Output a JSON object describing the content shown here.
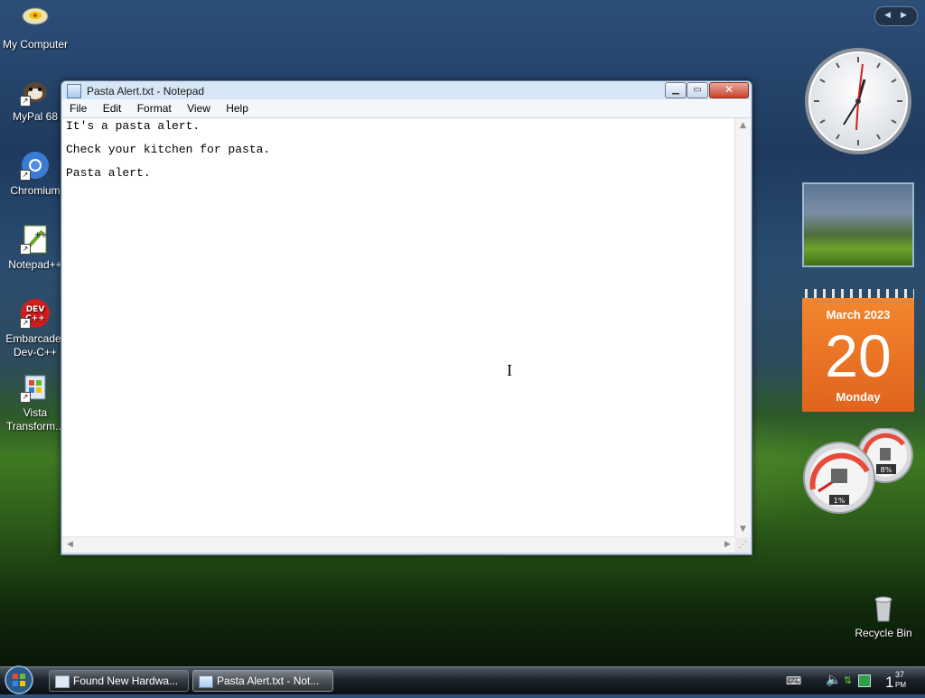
{
  "desktop": {
    "icons": [
      {
        "label": "My Computer"
      },
      {
        "label": "MyPal 68"
      },
      {
        "label": "Chromium"
      },
      {
        "label": "Notepad++"
      },
      {
        "label": "Embarcadero Dev-C++",
        "line1": "Embarcader",
        "line2": "Dev-C++"
      },
      {
        "label": "Vista Transform...",
        "line1": "Vista",
        "line2": "Transform..."
      }
    ],
    "recycle_bin": {
      "label": "Recycle Bin"
    }
  },
  "notepad": {
    "title": "Pasta Alert.txt - Notepad",
    "menu": [
      "File",
      "Edit",
      "Format",
      "View",
      "Help"
    ],
    "lines": [
      "It's a pasta alert.",
      "Check your kitchen for pasta.",
      "Pasta alert."
    ]
  },
  "sidebar": {
    "calendar": {
      "month_year": "March 2023",
      "day": "20",
      "weekday": "Monday"
    },
    "meters": {
      "cpu": "1%",
      "memory": "8%"
    },
    "colors": {
      "calendar_orange": "#e8701f"
    }
  },
  "taskbar": {
    "buttons": [
      {
        "label": "Found New Hardwa...",
        "active": false
      },
      {
        "label": "Pasta Alert.txt - Not...",
        "active": true
      }
    ],
    "clock": {
      "hour_min": "1",
      "minutes": "37",
      "ampm": "PM"
    }
  }
}
